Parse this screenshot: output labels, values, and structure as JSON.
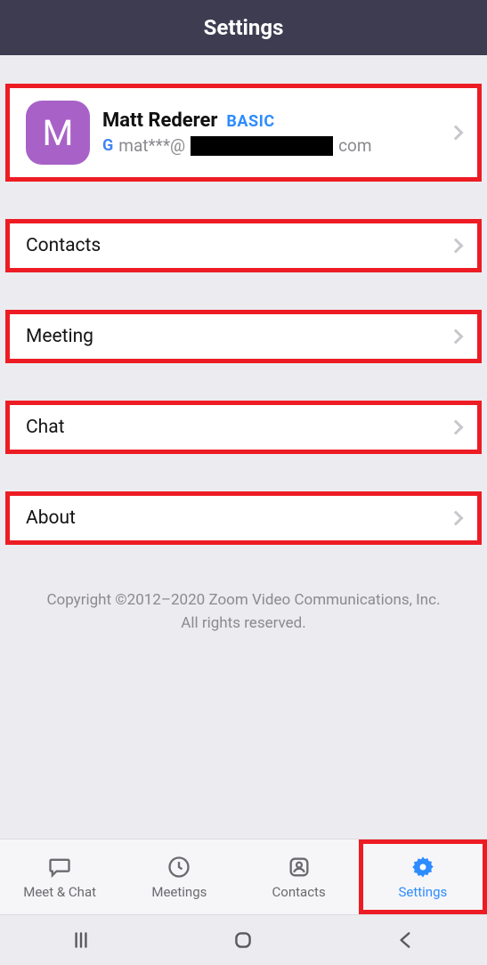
{
  "header": {
    "title": "Settings"
  },
  "profile": {
    "initial": "M",
    "name": "Matt Rederer",
    "badge": "BASIC",
    "email_prefix": "mat***@",
    "email_suffix": "com"
  },
  "rows": {
    "contacts": "Contacts",
    "meeting": "Meeting",
    "chat": "Chat",
    "about": "About"
  },
  "footer": {
    "line1": "Copyright ©2012–2020 Zoom Video Communications, Inc.",
    "line2": "All rights reserved."
  },
  "tabs": {
    "meet_chat": "Meet & Chat",
    "meetings": "Meetings",
    "contacts": "Contacts",
    "settings": "Settings"
  }
}
